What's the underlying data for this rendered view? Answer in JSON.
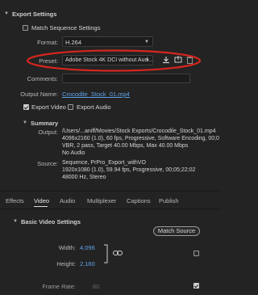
{
  "export_settings": {
    "title": "Export Settings",
    "match_sequence_label": "Match Sequence Settings",
    "format_label": "Format:",
    "format_value": "H.264",
    "preset_label": "Preset:",
    "preset_value": "Adobe Stock 4K DCI without Aud...",
    "comments_label": "Comments:",
    "comments_value": "",
    "output_name_label": "Output Name:",
    "output_name_value": "Crocodile_Stock_01.mp4",
    "export_video_label": "Export Video",
    "export_audio_label": "Export Audio",
    "export_video_checked": true,
    "export_audio_checked": false
  },
  "summary": {
    "title": "Summary",
    "output_label": "Output:",
    "output_lines": [
      "/Users/...aniff/Movies/Stock Exports/Crocodile_Stock_01.mp4",
      "4096x2160 (1.0), 60 fps, Progressive, Software Encoding, 00;0",
      "VBR, 2 pass, Target 40.00 Mbps, Max 40.00 Mbps",
      "No Audio"
    ],
    "source_label": "Source:",
    "source_lines": [
      "Sequence, PrPro_Export_withVO",
      "1920x1080 (1.0), 59.94 fps, Progressive, 00;05;22;02",
      "48000 Hz, Stereo"
    ]
  },
  "tabs": [
    "Effects",
    "Video",
    "Audio",
    "Multiplexer",
    "Captions",
    "Publish"
  ],
  "active_tab": "Video",
  "basic_video": {
    "title": "Basic Video Settings",
    "match_source_label": "Match Source",
    "width_label": "Width:",
    "width_value": "4,096",
    "height_label": "Height:",
    "height_value": "2,160",
    "frame_rate_label": "Frame Rate:",
    "frame_rate_value": "60"
  },
  "colors": {
    "annotation_ellipse": "#d7261e",
    "link": "#5fa3e8"
  }
}
